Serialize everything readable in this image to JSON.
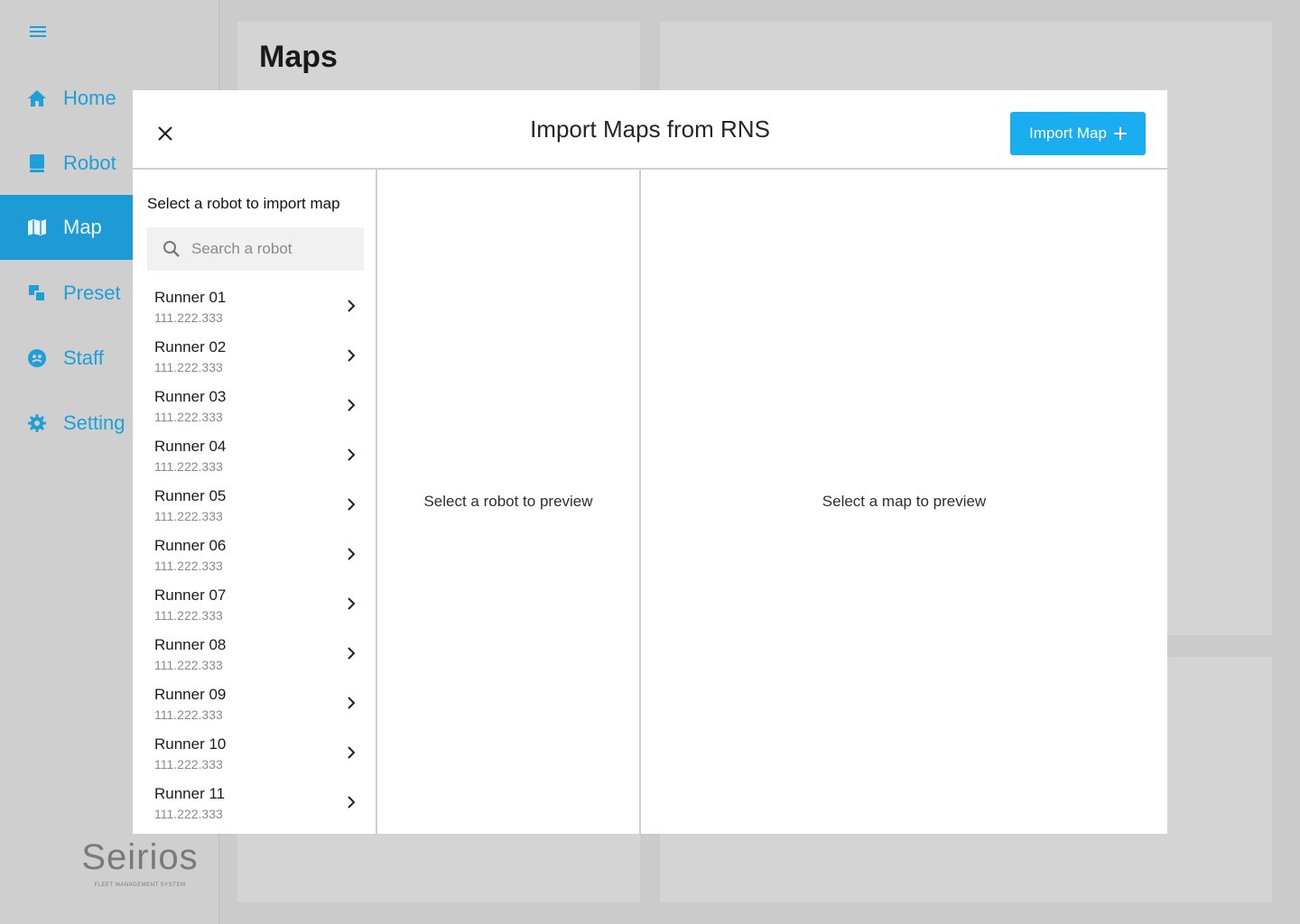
{
  "sidebar": {
    "items": [
      {
        "label": "Home",
        "icon": "home-icon"
      },
      {
        "label": "Robot",
        "icon": "robot-icon"
      },
      {
        "label": "Map",
        "icon": "map-icon",
        "active": true
      },
      {
        "label": "Preset",
        "icon": "preset-icon"
      },
      {
        "label": "Staff",
        "icon": "staff-icon"
      },
      {
        "label": "Setting",
        "icon": "gear-icon"
      }
    ],
    "logo": {
      "word": "Seirios",
      "tagline": "FLEET MANAGEMENT SYSTEM"
    }
  },
  "page": {
    "title": "Maps"
  },
  "modal": {
    "title": "Import Maps from RNS",
    "import_button": "Import Map",
    "left": {
      "heading": "Select a robot to import map",
      "search_placeholder": "Search a robot"
    },
    "middle_placeholder": "Select a robot to preview",
    "right_placeholder": "Select a map to preview"
  },
  "robots": [
    {
      "name": "Runner 01",
      "ip": "111.222.333"
    },
    {
      "name": "Runner 02",
      "ip": "111.222.333"
    },
    {
      "name": "Runner 03",
      "ip": "111.222.333"
    },
    {
      "name": "Runner 04",
      "ip": "111.222.333"
    },
    {
      "name": "Runner 05",
      "ip": "111.222.333"
    },
    {
      "name": "Runner 06",
      "ip": "111.222.333"
    },
    {
      "name": "Runner 07",
      "ip": "111.222.333"
    },
    {
      "name": "Runner 08",
      "ip": "111.222.333"
    },
    {
      "name": "Runner 09",
      "ip": "111.222.333"
    },
    {
      "name": "Runner 10",
      "ip": "111.222.333"
    },
    {
      "name": "Runner 11",
      "ip": "111.222.333"
    }
  ],
  "colors": {
    "accent": "#1e9fd8",
    "button": "#1aaef0",
    "overlay": "#cbcbcb"
  }
}
